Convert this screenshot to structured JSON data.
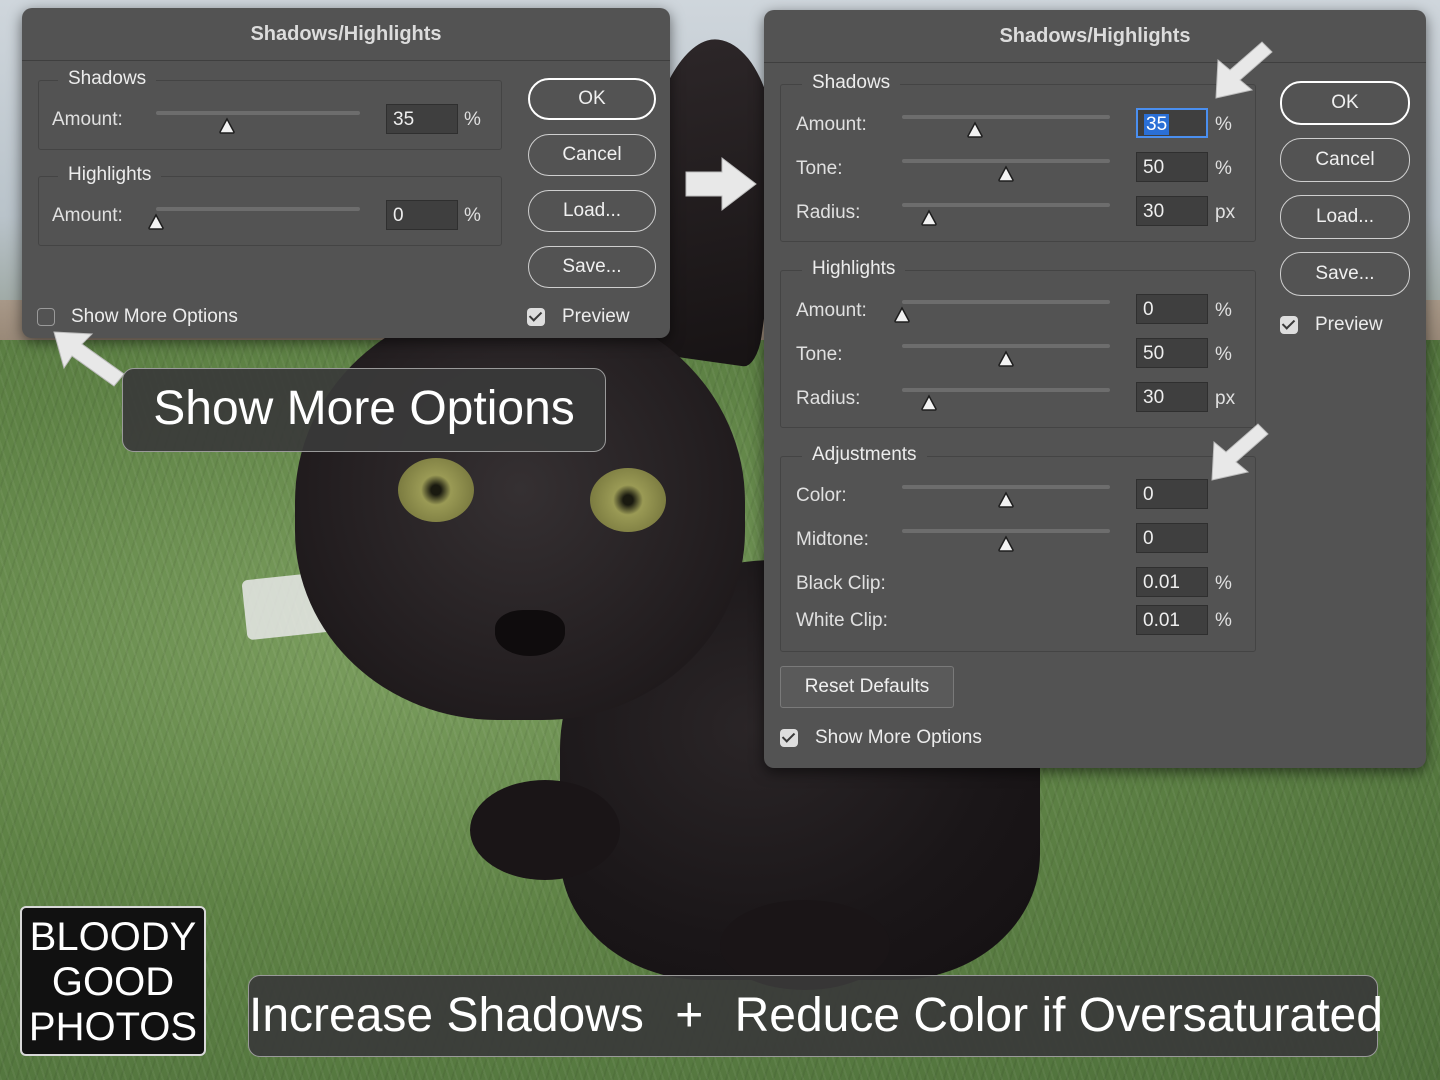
{
  "small_dialog": {
    "title": "Shadows/Highlights",
    "shadows": {
      "legend": "Shadows",
      "amount_label": "Amount:",
      "amount_value": "35",
      "amount_unit": "%",
      "amount_level": 0.35
    },
    "highlights": {
      "legend": "Highlights",
      "amount_label": "Amount:",
      "amount_value": "0",
      "amount_unit": "%",
      "amount_level": 0.0
    },
    "buttons": {
      "ok": "OK",
      "cancel": "Cancel",
      "load": "Load...",
      "save": "Save..."
    },
    "show_more_options": {
      "label": "Show More Options",
      "checked": false
    },
    "preview": {
      "label": "Preview",
      "checked": true
    }
  },
  "large_dialog": {
    "title": "Shadows/Highlights",
    "shadows": {
      "legend": "Shadows",
      "amount_label": "Amount:",
      "amount_value": "35",
      "amount_unit": "%",
      "amount_level": 0.35,
      "tone_label": "Tone:",
      "tone_value": "50",
      "tone_unit": "%",
      "tone_level": 0.5,
      "radius_label": "Radius:",
      "radius_value": "30",
      "radius_unit": "px",
      "radius_level": 0.13
    },
    "highlights": {
      "legend": "Highlights",
      "amount_label": "Amount:",
      "amount_value": "0",
      "amount_unit": "%",
      "amount_level": 0.0,
      "tone_label": "Tone:",
      "tone_value": "50",
      "tone_unit": "%",
      "tone_level": 0.5,
      "radius_label": "Radius:",
      "radius_value": "30",
      "radius_unit": "px",
      "radius_level": 0.13
    },
    "adjustments": {
      "legend": "Adjustments",
      "color_label": "Color:",
      "color_value": "0",
      "color_level": 0.5,
      "midtone_label": "Midtone:",
      "midtone_value": "0",
      "midtone_level": 0.5,
      "black_clip_label": "Black Clip:",
      "black_clip_value": "0.01",
      "black_clip_unit": "%",
      "white_clip_label": "White Clip:",
      "white_clip_value": "0.01",
      "white_clip_unit": "%"
    },
    "buttons": {
      "ok": "OK",
      "cancel": "Cancel",
      "load": "Load...",
      "save": "Save...",
      "reset": "Reset Defaults"
    },
    "show_more_options": {
      "label": "Show More Options",
      "checked": true
    },
    "preview": {
      "label": "Preview",
      "checked": true
    }
  },
  "overlay": {
    "show_more_banner": "Show More Options",
    "caption_left": "Increase Shadows",
    "caption_plus": "+",
    "caption_right": "Reduce Color if Oversaturated",
    "logo_lines": [
      "BLOODY",
      "GOOD",
      "PHOTOS"
    ]
  },
  "colors": {
    "dialog_bg": "#535353",
    "field_bg": "#3f3f3f",
    "focus_ring": "#4a8ff0",
    "arrow": "#e8e8e8"
  }
}
